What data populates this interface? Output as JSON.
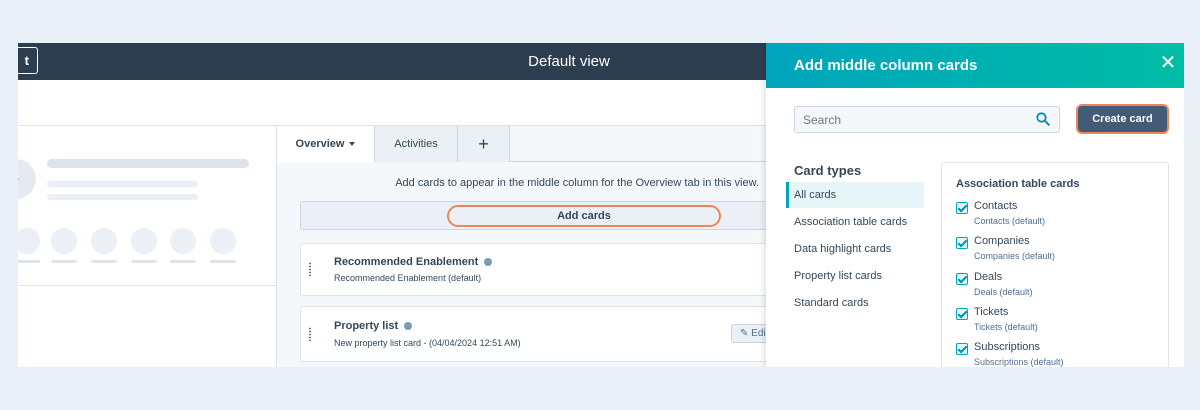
{
  "header": {
    "exit_label": "t",
    "view_title": "Default view"
  },
  "middle": {
    "tabs": [
      {
        "label": "Overview"
      },
      {
        "label": "Activities"
      },
      {
        "label": "+"
      }
    ],
    "hint": "Add cards to appear in the middle column for the Overview tab in this view.",
    "add_cards_label": "Add cards",
    "cards": [
      {
        "title": "Recommended Enablement",
        "subtitle": "Recommended Enablement (default)"
      },
      {
        "title": "Property list",
        "subtitle": "New property list card - (04/04/2024 12:51 AM)",
        "edit_label": "Edi"
      }
    ]
  },
  "panel": {
    "title": "Add middle column cards",
    "search_placeholder": "Search",
    "create_card_label": "Create card",
    "card_types_heading": "Card types",
    "card_types": [
      {
        "label": "All cards",
        "selected": true
      },
      {
        "label": "Association table cards"
      },
      {
        "label": "Data highlight cards"
      },
      {
        "label": "Property list cards"
      },
      {
        "label": "Standard cards"
      }
    ],
    "association_heading": "Association table cards",
    "association_cards": [
      {
        "label": "Contacts",
        "sub": "Contacts (default)"
      },
      {
        "label": "Companies",
        "sub": "Companies (default)"
      },
      {
        "label": "Deals",
        "sub": "Deals (default)"
      },
      {
        "label": "Tickets",
        "sub": "Tickets (default)"
      },
      {
        "label": "Subscriptions",
        "sub": "Subscriptions (default)"
      }
    ]
  },
  "colors": {
    "header_bg": "#2d3e50",
    "panel_header_start": "#00a4bd",
    "panel_header_end": "#00bda5",
    "highlight_outline": "#e8875a",
    "create_button_bg": "#425b76"
  }
}
